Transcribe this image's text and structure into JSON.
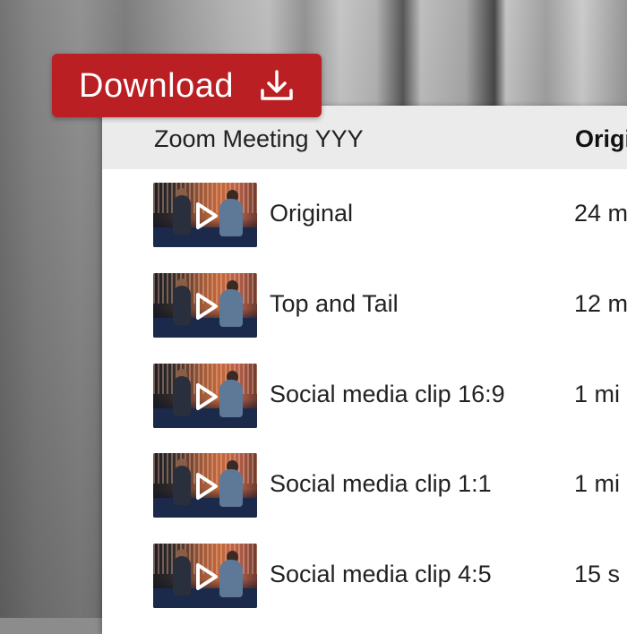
{
  "download_button": {
    "label": "Download",
    "icon": "download-icon",
    "color": "#b91f23"
  },
  "table": {
    "header": {
      "title": "Zoom Meeting YYY",
      "column": "Origi"
    },
    "rows": [
      {
        "label": "Original",
        "value": "24 m",
        "icon": "play-icon"
      },
      {
        "label": "Top and Tail",
        "value": "12 m",
        "icon": "play-icon"
      },
      {
        "label": "Social media clip 16:9",
        "value": "1 mi",
        "icon": "play-icon"
      },
      {
        "label": "Social media clip 1:1",
        "value": "1 mi",
        "icon": "play-icon"
      },
      {
        "label": "Social media clip 4:5",
        "value": "15 s",
        "icon": "play-icon"
      }
    ]
  }
}
